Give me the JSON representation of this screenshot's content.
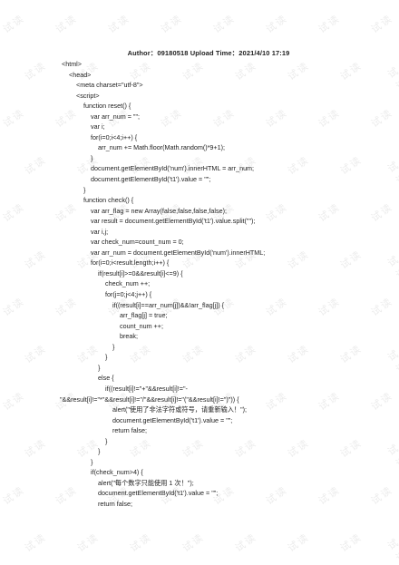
{
  "header": {
    "text": "Author：09180518 Upload Time：2021/4/10 17:19"
  },
  "watermark": {
    "text": "试读"
  },
  "code_lines": [
    {
      "indent": 0,
      "text": "<html>"
    },
    {
      "indent": 1,
      "text": "<head>"
    },
    {
      "indent": 2,
      "text": "<meta charset=\"utf-8\">"
    },
    {
      "indent": 2,
      "text": "<script>"
    },
    {
      "indent": 3,
      "text": "function reset() {"
    },
    {
      "indent": 4,
      "text": "var arr_num = \"\";"
    },
    {
      "indent": 4,
      "text": "var i;"
    },
    {
      "indent": 4,
      "text": "for(i=0;i<4;i++) {"
    },
    {
      "indent": 5,
      "text": "arr_num += Math.floor(Math.random()*9+1);"
    },
    {
      "indent": 4,
      "text": "}"
    },
    {
      "indent": 4,
      "text": "document.getElementById('num').innerHTML = arr_num;"
    },
    {
      "indent": 4,
      "text": "document.getElementById('t1').value = \"\";"
    },
    {
      "indent": 3,
      "text": "}"
    },
    {
      "indent": 3,
      "text": "function check() {"
    },
    {
      "indent": 4,
      "text": "var arr_flag = new Array(false,false,false,false);"
    },
    {
      "indent": 4,
      "text": "var result = document.getElementById('t1').value.split(\"\");"
    },
    {
      "indent": 4,
      "text": "var i,j;"
    },
    {
      "indent": 4,
      "text": "var check_num=count_num = 0;"
    },
    {
      "indent": 4,
      "text": "var arr_num = document.getElementById('num').innerHTML;"
    },
    {
      "indent": 4,
      "text": "for(i=0;i<result.length;i++) {"
    },
    {
      "indent": 5,
      "text": "if(result[i]>=0&&result[i]<=9) {"
    },
    {
      "indent": 6,
      "text": "check_num ++;"
    },
    {
      "indent": 6,
      "text": "for(j=0;j<4;j++) {"
    },
    {
      "indent": 7,
      "text": "if((result[i]==arr_num[j])&&!arr_flag[j]) {"
    },
    {
      "indent": 8,
      "text": "arr_flag[j] = true;"
    },
    {
      "indent": 8,
      "text": "count_num ++;"
    },
    {
      "indent": 8,
      "text": "break;"
    },
    {
      "indent": 7,
      "text": "}"
    },
    {
      "indent": 6,
      "text": "}"
    },
    {
      "indent": 5,
      "text": "}"
    },
    {
      "indent": 5,
      "text": "else {"
    },
    {
      "indent": 6,
      "text": "if((result[i]!=\"+\"&&result[i]!=\"-"
    },
    {
      "indent": -1,
      "text": "\"&&result[i]!=\"*\"&&result[i]!=\"/\"&&result[i]!=\"(\"&&result[i]!=\")\")) {"
    },
    {
      "indent": 7,
      "text": "alert(\"使用了非法字符或符号，请重新输入！\");"
    },
    {
      "indent": 7,
      "text": "document.getElementById('t1').value = \"\";"
    },
    {
      "indent": 7,
      "text": "return false;"
    },
    {
      "indent": 6,
      "text": "}"
    },
    {
      "indent": 5,
      "text": "}"
    },
    {
      "indent": 4,
      "text": "}"
    },
    {
      "indent": 4,
      "text": "if(check_num>4) {"
    },
    {
      "indent": 5,
      "text": "alert(\"每个数字只能使用 1 次！\");"
    },
    {
      "indent": 5,
      "text": "document.getElementById('t1').value = \"\";"
    },
    {
      "indent": 5,
      "text": "return false;"
    }
  ]
}
